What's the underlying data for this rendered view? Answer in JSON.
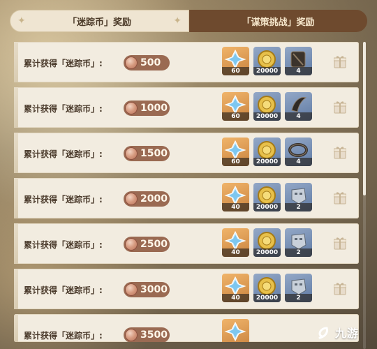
{
  "tabs": {
    "active_label": "「迷踪币」奖励",
    "inactive_label": "「谋策挑战」奖励"
  },
  "rows": [
    {
      "label": "累计获得「迷踪币」:",
      "amount": "500",
      "rewards": [
        "60",
        "20000",
        "4"
      ],
      "third_icon": "dark-chest-piece-icon"
    },
    {
      "label": "累计获得「迷踪币」:",
      "amount": "1000",
      "rewards": [
        "60",
        "20000",
        "4"
      ],
      "third_icon": "dark-horn-icon"
    },
    {
      "label": "累计获得「迷踪币」:",
      "amount": "1500",
      "rewards": [
        "60",
        "20000",
        "4"
      ],
      "third_icon": "dark-ring-icon"
    },
    {
      "label": "累计获得「迷踪币」:",
      "amount": "2000",
      "rewards": [
        "40",
        "20000",
        "2"
      ],
      "third_icon": "steel-mask-icon"
    },
    {
      "label": "累计获得「迷踪币」:",
      "amount": "2500",
      "rewards": [
        "40",
        "20000",
        "2"
      ],
      "third_icon": "steel-mask-icon"
    },
    {
      "label": "累计获得「迷踪币」:",
      "amount": "3000",
      "rewards": [
        "40",
        "20000",
        "2"
      ],
      "third_icon": "steel-mask-icon"
    },
    {
      "label": "累计获得「迷踪币」:",
      "amount": "3500",
      "rewards": [
        "",
        "",
        ""
      ],
      "third_icon": "steel-mask-icon"
    }
  ],
  "watermark": {
    "text": "九游"
  },
  "colors": {
    "accent_gold": "#e0a45a",
    "pill": "#9a6a52",
    "tab_inactive": "#6e4a2e"
  }
}
